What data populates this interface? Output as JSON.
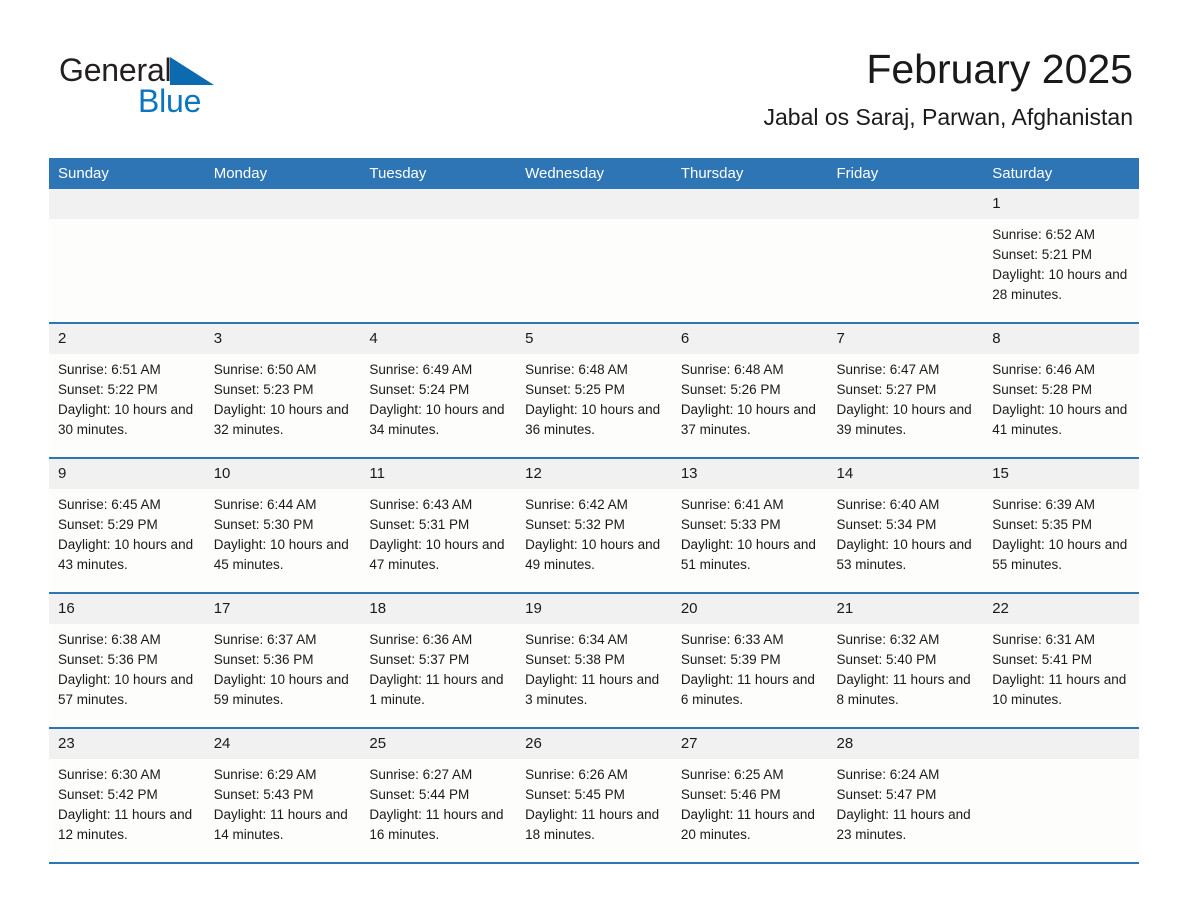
{
  "brand": {
    "name_part1": "General",
    "name_part2": "Blue",
    "triangle_icon": "blue-triangle-icon",
    "accent_color": "#0b76bd"
  },
  "header": {
    "title": "February 2025",
    "subtitle": "Jabal os Saraj, Parwan, Afghanistan"
  },
  "theme": {
    "header_blue": "#2e75b6",
    "daynum_gray": "#f1f1f1",
    "cell_bg": "#fdfdfc"
  },
  "calendar": {
    "weekday_headers": [
      "Sunday",
      "Monday",
      "Tuesday",
      "Wednesday",
      "Thursday",
      "Friday",
      "Saturday"
    ],
    "labels": {
      "sunrise": "Sunrise:",
      "sunset": "Sunset:",
      "daylight": "Daylight:"
    },
    "weeks": [
      [
        {
          "day": "",
          "sunrise": "",
          "sunset": "",
          "daylight": ""
        },
        {
          "day": "",
          "sunrise": "",
          "sunset": "",
          "daylight": ""
        },
        {
          "day": "",
          "sunrise": "",
          "sunset": "",
          "daylight": ""
        },
        {
          "day": "",
          "sunrise": "",
          "sunset": "",
          "daylight": ""
        },
        {
          "day": "",
          "sunrise": "",
          "sunset": "",
          "daylight": ""
        },
        {
          "day": "",
          "sunrise": "",
          "sunset": "",
          "daylight": ""
        },
        {
          "day": "1",
          "sunrise": "Sunrise: 6:52 AM",
          "sunset": "Sunset: 5:21 PM",
          "daylight": "Daylight: 10 hours and 28 minutes."
        }
      ],
      [
        {
          "day": "2",
          "sunrise": "Sunrise: 6:51 AM",
          "sunset": "Sunset: 5:22 PM",
          "daylight": "Daylight: 10 hours and 30 minutes."
        },
        {
          "day": "3",
          "sunrise": "Sunrise: 6:50 AM",
          "sunset": "Sunset: 5:23 PM",
          "daylight": "Daylight: 10 hours and 32 minutes."
        },
        {
          "day": "4",
          "sunrise": "Sunrise: 6:49 AM",
          "sunset": "Sunset: 5:24 PM",
          "daylight": "Daylight: 10 hours and 34 minutes."
        },
        {
          "day": "5",
          "sunrise": "Sunrise: 6:48 AM",
          "sunset": "Sunset: 5:25 PM",
          "daylight": "Daylight: 10 hours and 36 minutes."
        },
        {
          "day": "6",
          "sunrise": "Sunrise: 6:48 AM",
          "sunset": "Sunset: 5:26 PM",
          "daylight": "Daylight: 10 hours and 37 minutes."
        },
        {
          "day": "7",
          "sunrise": "Sunrise: 6:47 AM",
          "sunset": "Sunset: 5:27 PM",
          "daylight": "Daylight: 10 hours and 39 minutes."
        },
        {
          "day": "8",
          "sunrise": "Sunrise: 6:46 AM",
          "sunset": "Sunset: 5:28 PM",
          "daylight": "Daylight: 10 hours and 41 minutes."
        }
      ],
      [
        {
          "day": "9",
          "sunrise": "Sunrise: 6:45 AM",
          "sunset": "Sunset: 5:29 PM",
          "daylight": "Daylight: 10 hours and 43 minutes."
        },
        {
          "day": "10",
          "sunrise": "Sunrise: 6:44 AM",
          "sunset": "Sunset: 5:30 PM",
          "daylight": "Daylight: 10 hours and 45 minutes."
        },
        {
          "day": "11",
          "sunrise": "Sunrise: 6:43 AM",
          "sunset": "Sunset: 5:31 PM",
          "daylight": "Daylight: 10 hours and 47 minutes."
        },
        {
          "day": "12",
          "sunrise": "Sunrise: 6:42 AM",
          "sunset": "Sunset: 5:32 PM",
          "daylight": "Daylight: 10 hours and 49 minutes."
        },
        {
          "day": "13",
          "sunrise": "Sunrise: 6:41 AM",
          "sunset": "Sunset: 5:33 PM",
          "daylight": "Daylight: 10 hours and 51 minutes."
        },
        {
          "day": "14",
          "sunrise": "Sunrise: 6:40 AM",
          "sunset": "Sunset: 5:34 PM",
          "daylight": "Daylight: 10 hours and 53 minutes."
        },
        {
          "day": "15",
          "sunrise": "Sunrise: 6:39 AM",
          "sunset": "Sunset: 5:35 PM",
          "daylight": "Daylight: 10 hours and 55 minutes."
        }
      ],
      [
        {
          "day": "16",
          "sunrise": "Sunrise: 6:38 AM",
          "sunset": "Sunset: 5:36 PM",
          "daylight": "Daylight: 10 hours and 57 minutes."
        },
        {
          "day": "17",
          "sunrise": "Sunrise: 6:37 AM",
          "sunset": "Sunset: 5:36 PM",
          "daylight": "Daylight: 10 hours and 59 minutes."
        },
        {
          "day": "18",
          "sunrise": "Sunrise: 6:36 AM",
          "sunset": "Sunset: 5:37 PM",
          "daylight": "Daylight: 11 hours and 1 minute."
        },
        {
          "day": "19",
          "sunrise": "Sunrise: 6:34 AM",
          "sunset": "Sunset: 5:38 PM",
          "daylight": "Daylight: 11 hours and 3 minutes."
        },
        {
          "day": "20",
          "sunrise": "Sunrise: 6:33 AM",
          "sunset": "Sunset: 5:39 PM",
          "daylight": "Daylight: 11 hours and 6 minutes."
        },
        {
          "day": "21",
          "sunrise": "Sunrise: 6:32 AM",
          "sunset": "Sunset: 5:40 PM",
          "daylight": "Daylight: 11 hours and 8 minutes."
        },
        {
          "day": "22",
          "sunrise": "Sunrise: 6:31 AM",
          "sunset": "Sunset: 5:41 PM",
          "daylight": "Daylight: 11 hours and 10 minutes."
        }
      ],
      [
        {
          "day": "23",
          "sunrise": "Sunrise: 6:30 AM",
          "sunset": "Sunset: 5:42 PM",
          "daylight": "Daylight: 11 hours and 12 minutes."
        },
        {
          "day": "24",
          "sunrise": "Sunrise: 6:29 AM",
          "sunset": "Sunset: 5:43 PM",
          "daylight": "Daylight: 11 hours and 14 minutes."
        },
        {
          "day": "25",
          "sunrise": "Sunrise: 6:27 AM",
          "sunset": "Sunset: 5:44 PM",
          "daylight": "Daylight: 11 hours and 16 minutes."
        },
        {
          "day": "26",
          "sunrise": "Sunrise: 6:26 AM",
          "sunset": "Sunset: 5:45 PM",
          "daylight": "Daylight: 11 hours and 18 minutes."
        },
        {
          "day": "27",
          "sunrise": "Sunrise: 6:25 AM",
          "sunset": "Sunset: 5:46 PM",
          "daylight": "Daylight: 11 hours and 20 minutes."
        },
        {
          "day": "28",
          "sunrise": "Sunrise: 6:24 AM",
          "sunset": "Sunset: 5:47 PM",
          "daylight": "Daylight: 11 hours and 23 minutes."
        },
        {
          "day": "",
          "sunrise": "",
          "sunset": "",
          "daylight": ""
        }
      ]
    ]
  }
}
